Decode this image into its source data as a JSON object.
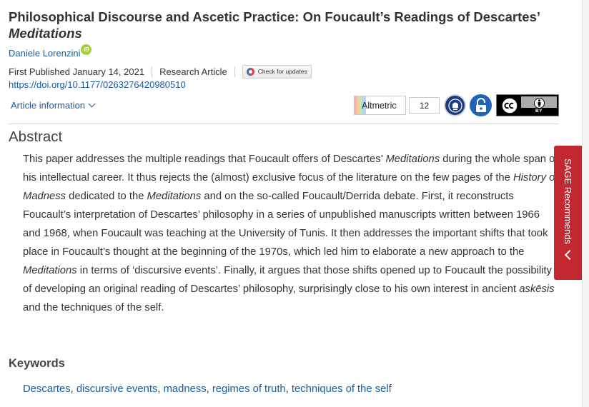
{
  "article": {
    "title_main": "Philosophical Discourse and Ascetic Practice: On Foucault’s Readings of Descartes’",
    "title_italic": "Meditations",
    "author": "Daniele Lorenzini",
    "orcid_label": "iD",
    "published": "First Published January 14, 2021",
    "article_type": "Research Article",
    "check_updates_label": "Check for updates",
    "doi": "https://doi.org/10.1177/0263276420980510",
    "article_info_label": "Article information"
  },
  "badges": {
    "altmetric_label": "Altmetric",
    "altmetric_count": "12",
    "cc_by_label": "BY",
    "icons": [
      "altmetric-ribbon",
      "open-access-seal",
      "open-lock-icon",
      "cc-by-license"
    ]
  },
  "abstract": {
    "heading": "Abstract",
    "p1": "This paper addresses the multiple readings that Foucault offers of Descartes’ ",
    "i1": "Meditations",
    "p2": " during the whole span of his intellectual career. It thus rejects the (almost) exclusive focus of the literature on the few pages of the ",
    "i2": "History of Madness",
    "p3": " dedicated to the ",
    "i3": "Meditations",
    "p4": " and on the so-called Foucault/Derrida debate. First, it reconstructs Foucault’s interpretation of Descartes’ philosophy in a series of unpublished manuscripts written between 1966 and 1968, when Foucault was teaching at the University of Tunis. It then addresses the important shifts that took place in Foucault’s thought at the beginning of the 1970s, which led him to elaborate a new approach to the ",
    "i4": "Meditations",
    "p5": " in terms of ‘discursive events’. Finally, it argues that those shifts opened up to Foucault the possibility of developing an original reading of Descartes’ philosophy, surprisingly close to his own interest in ancient ",
    "i5": "askēsis",
    "p6": " and the techniques of the self."
  },
  "keywords": {
    "heading": "Keywords",
    "items": [
      "Descartes",
      "discursive events",
      "madness",
      "regimes of truth",
      "techniques of the self"
    ],
    "separator": ", "
  },
  "sidebar": {
    "recommends_label": "SAGE Recommends"
  },
  "colors": {
    "link": "#1a5ba6",
    "sage_red": "#c3272f",
    "orcid_green": "#a6ce39"
  }
}
